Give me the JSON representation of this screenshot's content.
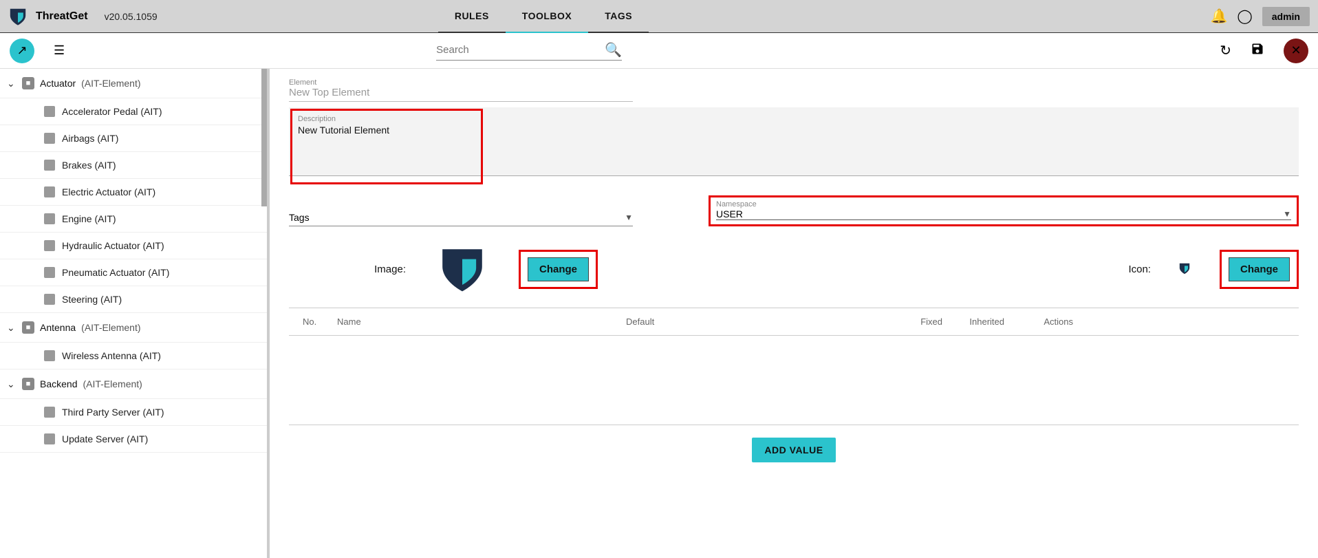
{
  "header": {
    "app_name": "ThreatGet",
    "version": "v20.05.1059",
    "tabs": {
      "rules": "RULES",
      "toolbox": "TOOLBOX",
      "tags": "TAGS"
    },
    "user_label": "admin"
  },
  "toolbar": {
    "search_placeholder": "Search"
  },
  "sidebar": {
    "groups": [
      {
        "name": "Actuator",
        "meta": "(AIT-Element)",
        "expanded": true,
        "items": [
          {
            "label": "Accelerator Pedal (AIT)"
          },
          {
            "label": "Airbags (AIT)"
          },
          {
            "label": "Brakes (AIT)"
          },
          {
            "label": "Electric Actuator (AIT)"
          },
          {
            "label": "Engine (AIT)"
          },
          {
            "label": "Hydraulic Actuator (AIT)"
          },
          {
            "label": "Pneumatic Actuator (AIT)"
          },
          {
            "label": "Steering (AIT)"
          }
        ]
      },
      {
        "name": "Antenna",
        "meta": "(AIT-Element)",
        "expanded": true,
        "items": [
          {
            "label": "Wireless Antenna (AIT)"
          }
        ]
      },
      {
        "name": "Backend",
        "meta": "(AIT-Element)",
        "expanded": true,
        "items": [
          {
            "label": "Third Party Server (AIT)"
          },
          {
            "label": "Update Server (AIT)"
          }
        ]
      }
    ]
  },
  "form": {
    "element_label": "Element",
    "element_value": "New Top Element",
    "description_label": "Description",
    "description_value": "New Tutorial Element",
    "tags_label": "Tags",
    "namespace_label": "Namespace",
    "namespace_value": "USER",
    "image_label": "Image:",
    "icon_label": "Icon:",
    "change_btn": "Change",
    "add_value_btn": "ADD VALUE"
  },
  "table": {
    "columns": {
      "no": "No.",
      "name": "Name",
      "default": "Default",
      "fixed": "Fixed",
      "inherited": "Inherited",
      "actions": "Actions"
    }
  }
}
